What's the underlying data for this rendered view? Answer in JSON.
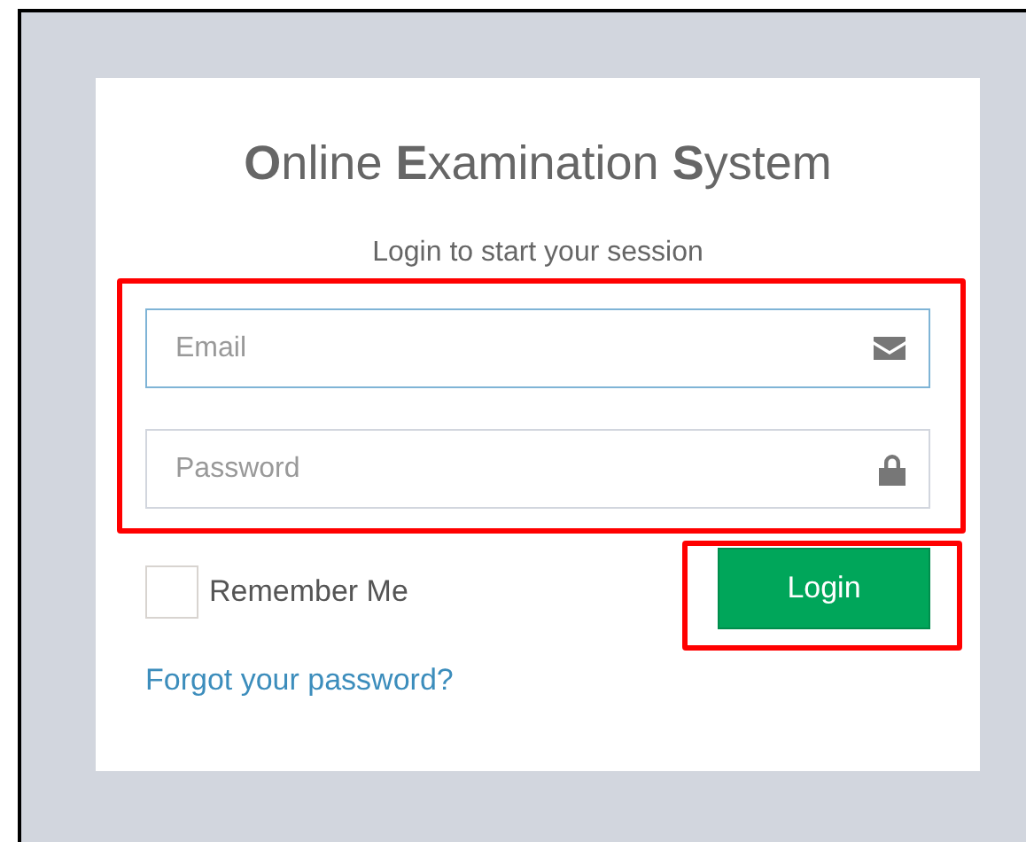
{
  "title": "**O**nline **E**xamination **S**ystem",
  "subtitle": "Login to start your session",
  "fields": [
    {
      "kind": "email",
      "placeholder": "Email",
      "focused": true
    },
    {
      "kind": "password",
      "placeholder": "Password",
      "focused": false
    }
  ],
  "remember": {
    "label": "Remember Me",
    "checked": false
  },
  "login_button": "Login",
  "forgot_link": "Forgot your password?"
}
